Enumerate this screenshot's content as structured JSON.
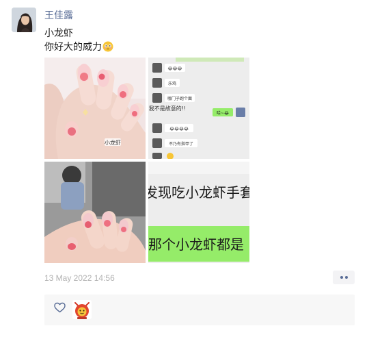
{
  "post": {
    "author": "王佳露",
    "text_line1": "小龙虾",
    "text_line2": "你好大的威力",
    "emoji": "flushed-face-emoji",
    "timestamp": "13 May 2022 14:56"
  },
  "photos": [
    {
      "name": "photo-nails-hand",
      "caption": "小龙虾"
    },
    {
      "name": "photo-chat-screenshot",
      "bubbles": [
        "😂😂😂",
        "乐鸡",
        "哪门子跑个面",
        "我不是故意的!!",
        "哈~😂",
        "😂😂😂😂",
        "不乃有指甲了"
      ]
    },
    {
      "name": "photo-nails-close"
    },
    {
      "name": "photo-chat-zoom",
      "line1": "发现吃小龙虾手套",
      "line2": "那个小龙虾都是"
    }
  ],
  "likes": {
    "icons": [
      "heart-outline-icon"
    ]
  },
  "colors": {
    "name_link": "#576b95",
    "timestamp": "#b2b2b2",
    "likes_bg": "#f7f7f7",
    "chat_green": "#95ec69"
  }
}
